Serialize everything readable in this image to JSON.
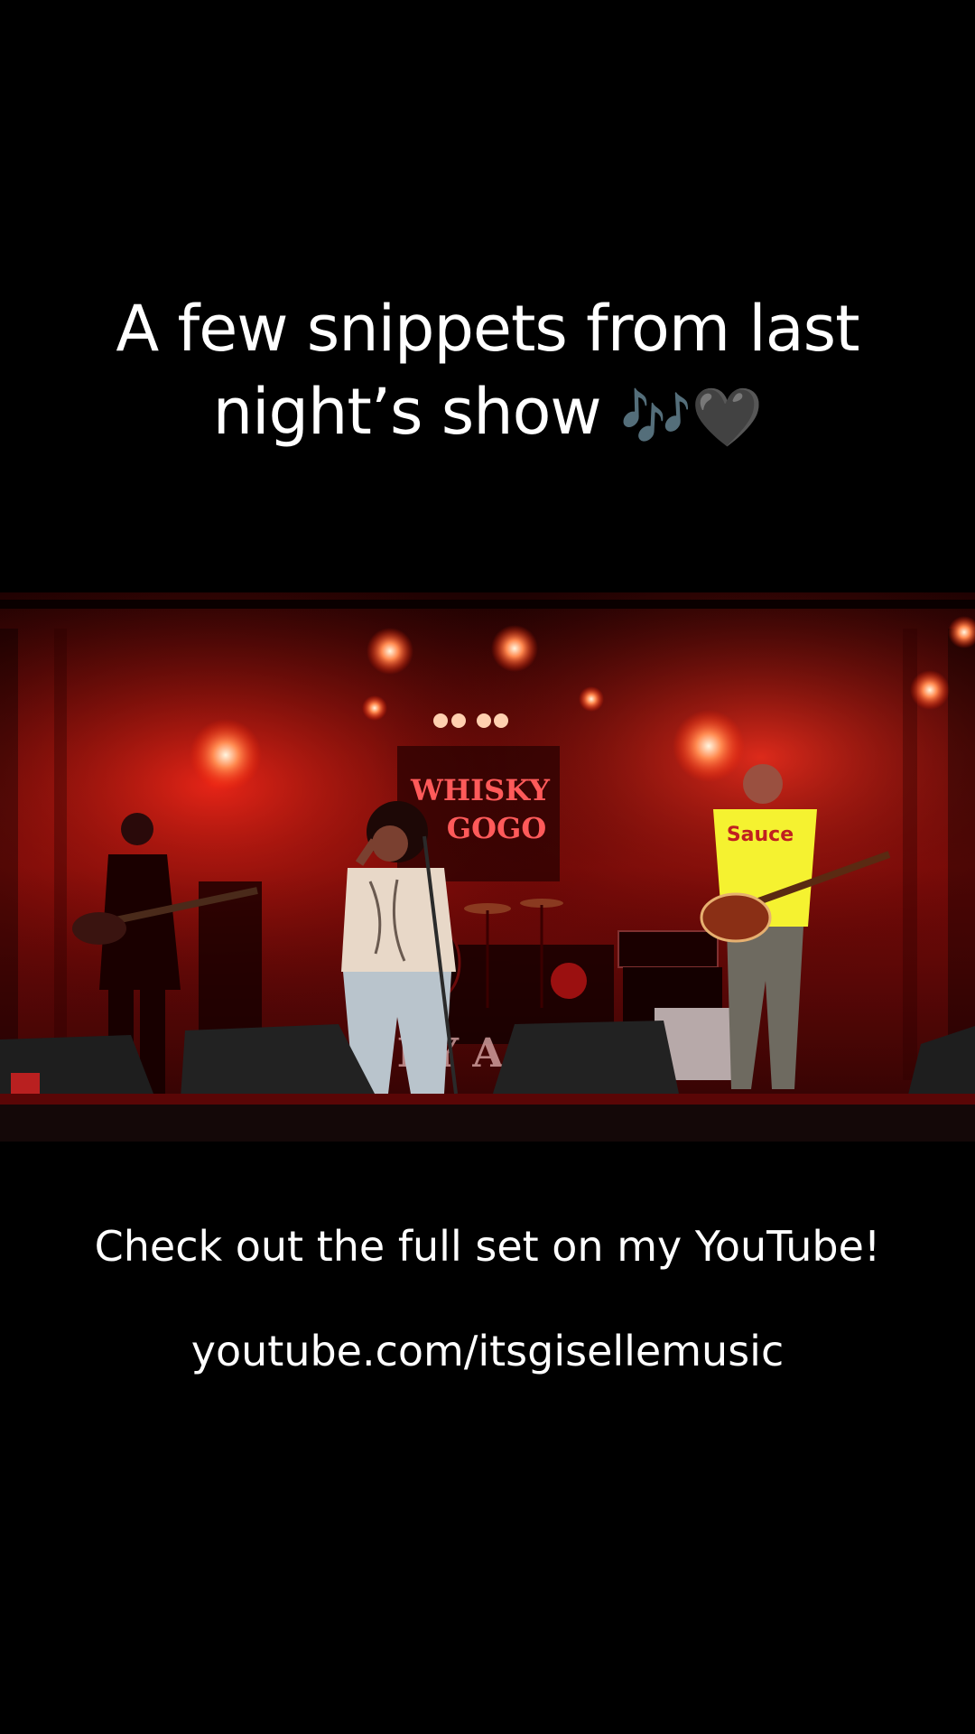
{
  "overlay": {
    "headline_line1": "A few snippets from last",
    "headline_line2": "night’s show",
    "headline_emoji": "🎶🖤",
    "cta": "Check out the full set on my YouTube!",
    "link": "youtube.com/itsgisellemusic"
  },
  "scene": {
    "venue_sign_line1": "WHISKY",
    "venue_sign_line2": "GOGO",
    "stage_text": "KY A G",
    "colors": {
      "background": "#000000",
      "stage_light": "#e31b1b",
      "guitarist_shirt": "#f5f230"
    }
  }
}
